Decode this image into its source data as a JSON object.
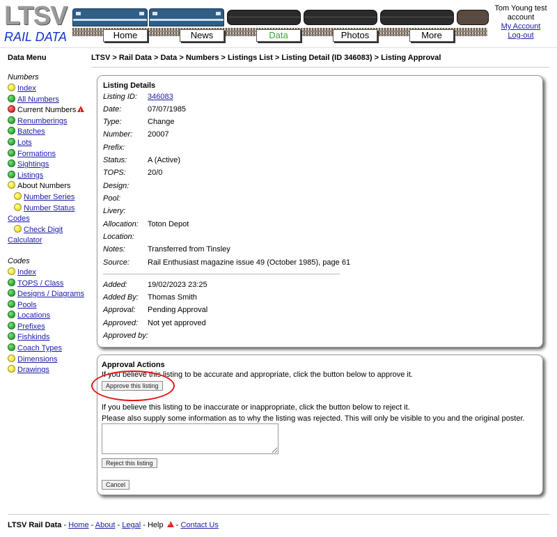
{
  "header": {
    "logo_top": "LTSV",
    "logo_bottom": "RAIL DATA",
    "nav": [
      {
        "label": "Home",
        "active": false
      },
      {
        "label": "News",
        "active": false
      },
      {
        "label": "Data",
        "active": true
      },
      {
        "label": "Photos",
        "active": false
      },
      {
        "label": "More",
        "active": false
      }
    ],
    "user_name": "Tom Young test account",
    "my_account": "My Account",
    "logout": "Log-out"
  },
  "sidebar": {
    "title": "Data Menu",
    "numbers_head": "Numbers",
    "numbers_items": [
      {
        "label": "Index",
        "dot": "yellow",
        "link": true
      },
      {
        "label": "All Numbers",
        "dot": "green",
        "link": true
      },
      {
        "label": "Current Numbers",
        "dot": "red",
        "link": false,
        "warn": true
      },
      {
        "label": "Renumberings",
        "dot": "green",
        "link": true
      },
      {
        "label": "Batches",
        "dot": "green",
        "link": true
      },
      {
        "label": "Lots",
        "dot": "green",
        "link": true
      },
      {
        "label": "Formations",
        "dot": "green",
        "link": true
      },
      {
        "label": "Sightings",
        "dot": "green",
        "link": true
      },
      {
        "label": "Listings",
        "dot": "green",
        "link": true
      },
      {
        "label": "About Numbers",
        "dot": "yellow",
        "link": false
      },
      {
        "label": "Number Series",
        "dot": "yellow",
        "link": true,
        "sub": true
      },
      {
        "label": "Number Status",
        "dot": "yellow",
        "link": true,
        "sub": true
      }
    ],
    "codes_link": "Codes",
    "check_digit": "Check Digit",
    "calculator": "Calculator",
    "codes_head": "Codes",
    "codes_items": [
      {
        "label": "Index",
        "dot": "yellow"
      },
      {
        "label": "TOPS / Class",
        "dot": "green"
      },
      {
        "label": "Designs / Diagrams",
        "dot": "green"
      },
      {
        "label": "Pools",
        "dot": "green"
      },
      {
        "label": "Locations",
        "dot": "green"
      },
      {
        "label": "Prefixes",
        "dot": "green"
      },
      {
        "label": "Fishkinds",
        "dot": "green"
      },
      {
        "label": "Coach Types",
        "dot": "green"
      },
      {
        "label": "Dimensions",
        "dot": "yellow"
      },
      {
        "label": "Drawings",
        "dot": "yellow"
      }
    ]
  },
  "breadcrumb": "LTSV > Rail Data > Data > Numbers > Listings List > Listing Detail (ID 346083) > Listing Approval",
  "details": {
    "title": "Listing Details",
    "rows": [
      {
        "label": "Listing ID:",
        "value": "346083",
        "link": true
      },
      {
        "label": "Date:",
        "value": "07/07/1985"
      },
      {
        "label": "Type:",
        "value": "Change"
      },
      {
        "label": "Number:",
        "value": "20007"
      },
      {
        "label": "Prefix:",
        "value": ""
      },
      {
        "label": "Status:",
        "value": "A (Active)"
      },
      {
        "label": "TOPS:",
        "value": "20/0"
      },
      {
        "label": "Design:",
        "value": ""
      },
      {
        "label": "Pool:",
        "value": ""
      },
      {
        "label": "Livery:",
        "value": ""
      },
      {
        "label": "Allocation:",
        "value": "Toton Depot"
      },
      {
        "label": "Location:",
        "value": ""
      },
      {
        "label": "Notes:",
        "value": "Transferred from Tinsley"
      },
      {
        "label": "Source:",
        "value": "Rail Enthusiast magazine issue 49 (October 1985), page 61"
      }
    ],
    "meta_rows": [
      {
        "label": "Added:",
        "value": "19/02/2023 23:25"
      },
      {
        "label": "Added By:",
        "value": "Thomas Smith"
      },
      {
        "label": "Approval:",
        "value": "Pending Approval"
      },
      {
        "label": "Approved:",
        "value": "Not yet approved"
      },
      {
        "label": "Approved by:",
        "value": ""
      }
    ]
  },
  "actions": {
    "title": "Approval Actions",
    "approve_text": "If you believe this listing to be accurate and appropriate, click the button below to approve it.",
    "approve_button": "Approve this listing",
    "reject_text": "If you believe this listing to be inaccurate or inappropriate, click the button below to reject it.",
    "reject_info": "Please also supply some information as to why the listing was rejected. This will only be visible to you and the original poster.",
    "reason_value": "",
    "reject_button": "Reject this listing",
    "cancel_button": "Cancel"
  },
  "footer": {
    "site": "LTSV Rail Data",
    "sep": " - ",
    "home": "Home",
    "about": "About",
    "legal": "Legal",
    "help": "Help",
    "contact": "Contact Us"
  },
  "colors": {
    "link": "#1a1aa6",
    "nav_active": "#33aa33",
    "highlight_circle": "#e01515",
    "logo_blue": "#1133cc"
  }
}
